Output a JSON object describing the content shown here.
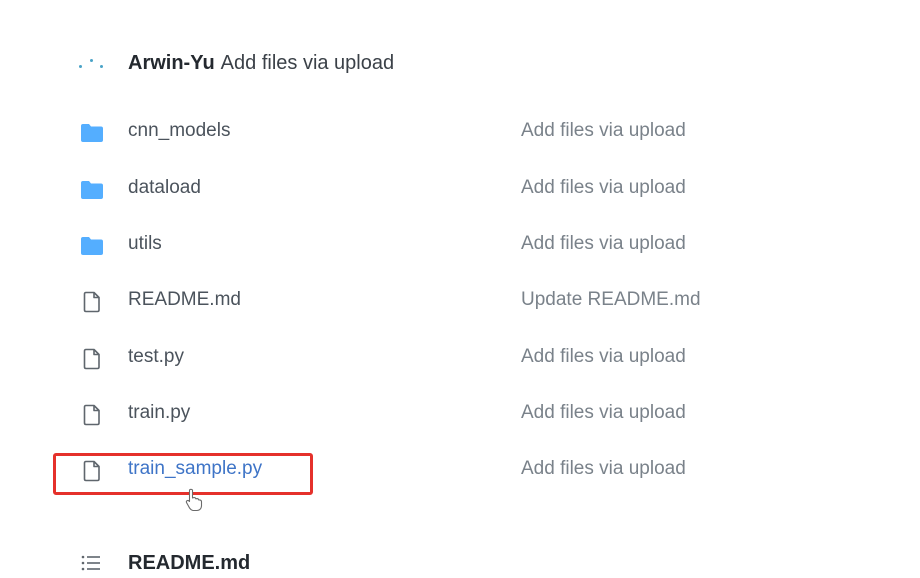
{
  "commit": {
    "author": "Arwin-Yu",
    "message": "Add files via upload"
  },
  "files": [
    {
      "name": "cnn_models",
      "type": "folder",
      "commit_message": "Add files via upload"
    },
    {
      "name": "dataload",
      "type": "folder",
      "commit_message": "Add files via upload"
    },
    {
      "name": "utils",
      "type": "folder",
      "commit_message": "Add files via upload"
    },
    {
      "name": "README.md",
      "type": "file",
      "commit_message": "Update README.md"
    },
    {
      "name": "test.py",
      "type": "file",
      "commit_message": "Add files via upload"
    },
    {
      "name": "train.py",
      "type": "file",
      "commit_message": "Add files via upload"
    },
    {
      "name": "train_sample.py",
      "type": "file",
      "commit_message": "Add files via upload"
    }
  ],
  "readme": {
    "title": "README.md",
    "icon": "list-icon"
  },
  "colors": {
    "folder": "#54aeff",
    "link": "#3e74c7",
    "highlight": "#e5312b"
  }
}
